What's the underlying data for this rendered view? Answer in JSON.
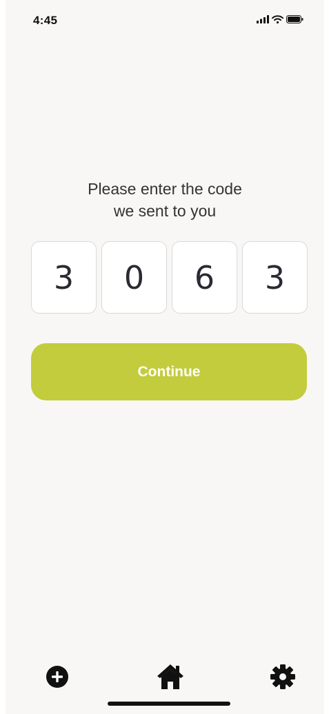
{
  "status_bar": {
    "time": "4:45",
    "icons": [
      "signal-icon",
      "wifi-icon",
      "battery-icon"
    ]
  },
  "prompt": {
    "line1": "Please enter the code",
    "line2": "we sent to you"
  },
  "code": {
    "digits": [
      "3",
      "0",
      "6",
      "3"
    ]
  },
  "continue_button": {
    "label": "Continue",
    "color": "#c3cc3c"
  },
  "tab_bar": {
    "items": [
      {
        "icon": "plus-circle-icon"
      },
      {
        "icon": "home-icon"
      },
      {
        "icon": "gear-icon"
      }
    ]
  },
  "colors": {
    "background": "#f8f7f5",
    "accent": "#c3cc3c",
    "text": "#333333"
  }
}
